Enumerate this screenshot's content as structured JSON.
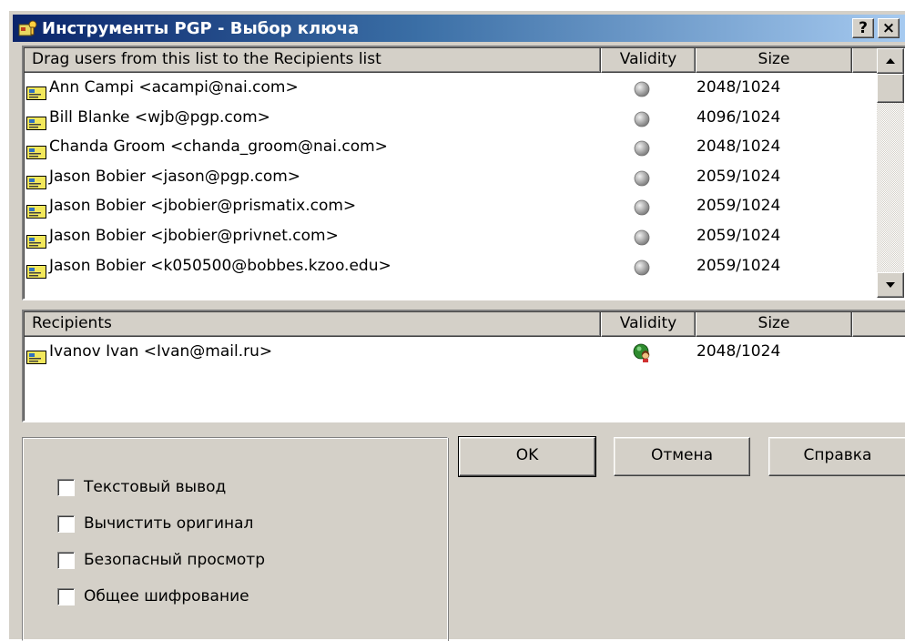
{
  "window": {
    "title": "Инструменты PGP - Выбор ключа",
    "help_button": "?",
    "close_button": "×",
    "icon": "pgp-keys-icon"
  },
  "key_list": {
    "columns": [
      "Drag users from this list to the Recipients list",
      "Validity",
      "Size"
    ],
    "rows": [
      {
        "name": "Ann Campi <acampi@nai.com>",
        "validity": "gray",
        "size": "2048/1024"
      },
      {
        "name": "Bill Blanke <wjb@pgp.com>",
        "validity": "gray",
        "size": "4096/1024"
      },
      {
        "name": "Chanda Groom <chanda_groom@nai.com>",
        "validity": "gray",
        "size": "2048/1024"
      },
      {
        "name": "Jason Bobier <jason@pgp.com>",
        "validity": "gray",
        "size": "2059/1024"
      },
      {
        "name": "Jason Bobier <jbobier@prismatix.com>",
        "validity": "gray",
        "size": "2059/1024"
      },
      {
        "name": "Jason Bobier <jbobier@privnet.com>",
        "validity": "gray",
        "size": "2059/1024"
      },
      {
        "name": "Jason Bobier <k050500@bobbes.kzoo.edu>",
        "validity": "gray",
        "size": "2059/1024"
      }
    ],
    "scroll_position": 0.0
  },
  "recipients": {
    "columns": [
      "Recipients",
      "Validity",
      "Size"
    ],
    "rows": [
      {
        "name": "Ivanov Ivan <Ivan@mail.ru>",
        "validity": "valid-user",
        "size": "2048/1024"
      }
    ]
  },
  "options": {
    "checkboxes": [
      {
        "label": "Текстовый вывод",
        "checked": false
      },
      {
        "label": "Вычистить оригинал",
        "checked": false
      },
      {
        "label": "Безопасный просмотр",
        "checked": false
      },
      {
        "label": "Общее шифрование",
        "checked": false
      }
    ]
  },
  "buttons": {
    "ok": "OK",
    "cancel": "Отмена",
    "help": "Справка"
  },
  "colors": {
    "title_gradient_start": "#0a246a",
    "title_gradient_end": "#a6caf0",
    "face": "#d4d0c8",
    "key_icon": "#f2e85c",
    "validity_gray": "#a8a8a8",
    "validity_green": "#2e8b2e"
  }
}
